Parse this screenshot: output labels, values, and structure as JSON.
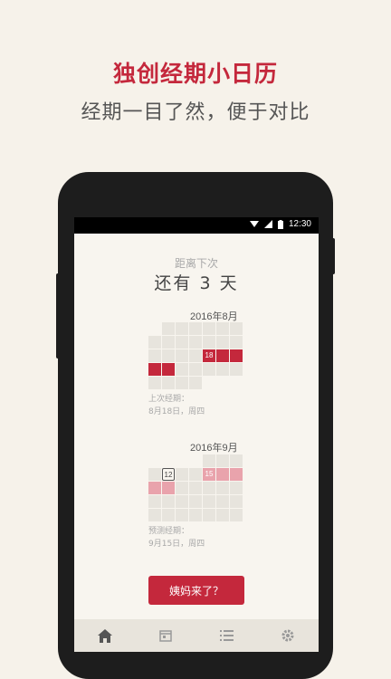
{
  "promo": {
    "title": "独创经期小日历",
    "subtitle": "经期一目了然，便于对比"
  },
  "status_bar": {
    "time": "12:30"
  },
  "countdown": {
    "label": "距离下次",
    "value": "还有 3 天"
  },
  "months": [
    {
      "title": "2016年8月",
      "period_day_label": "18",
      "info_label": "上次经期：",
      "info_date": "8月18日，周四"
    },
    {
      "title": "2016年9月",
      "today_label": "12",
      "predict_day_label": "15",
      "info_label": "预测经期：",
      "info_date": "9月15日，周四"
    }
  ],
  "action_button": "姨妈来了？",
  "tabs": [
    {
      "icon": "home-icon",
      "active": true
    },
    {
      "icon": "calendar-icon",
      "active": false
    },
    {
      "icon": "list-icon",
      "active": false
    },
    {
      "icon": "gear-icon",
      "active": false
    }
  ],
  "colors": {
    "accent": "#c4283c",
    "predict": "#e9a3ac",
    "background": "#f6f2ea"
  }
}
